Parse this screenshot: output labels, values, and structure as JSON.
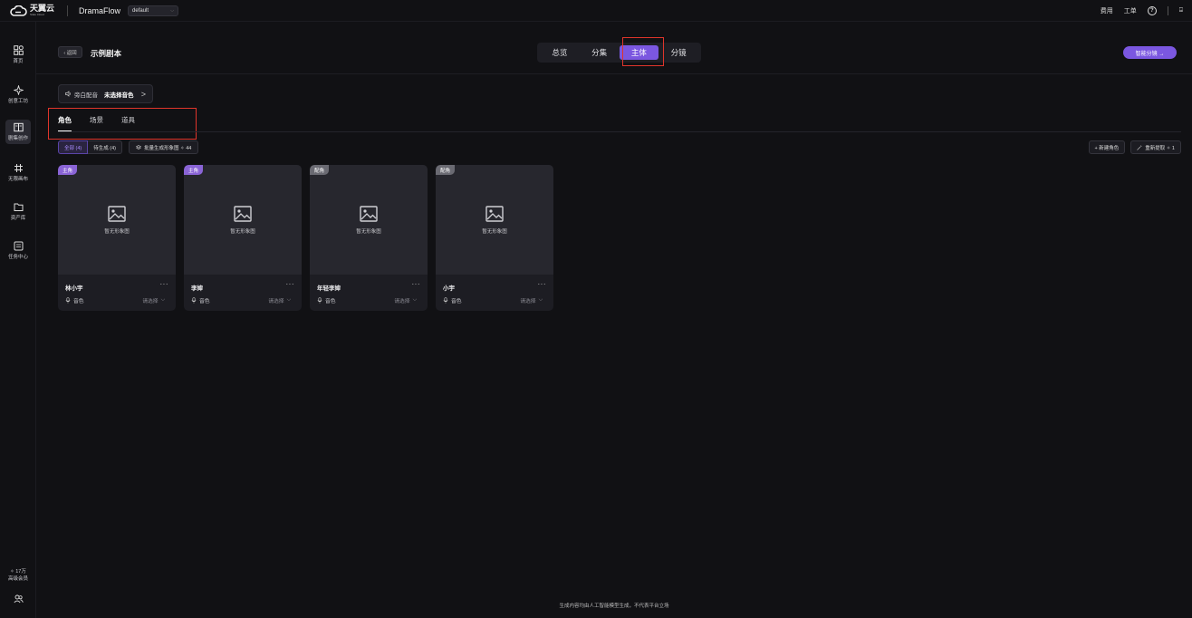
{
  "topbar": {
    "logo_zh": "天翼云",
    "logo_en": "State Cloud",
    "app_name": "DramaFlow",
    "env_select": "default",
    "right_items": [
      "费用",
      "工单"
    ],
    "help_glyph": "?",
    "user_glyph": "⍈"
  },
  "sidebar": {
    "items": [
      {
        "label": "首页",
        "icon": "grid-icon"
      },
      {
        "label": "创意工坊",
        "icon": "sparkle-icon"
      },
      {
        "label": "剧集创作",
        "icon": "book-icon"
      },
      {
        "label": "无限画布",
        "icon": "hash-icon"
      },
      {
        "label": "资产库",
        "icon": "folder-icon"
      },
      {
        "label": "任务中心",
        "icon": "task-icon"
      }
    ],
    "credits": "✧ 17万",
    "membership": "高级会员"
  },
  "header": {
    "back_label": "‹ 返回",
    "title": "示例剧本",
    "tabs": [
      "总览",
      "分集",
      "主体",
      "分镜"
    ],
    "active_tab": "主体",
    "smart_button": "智能分镜 →"
  },
  "voice": {
    "label": "旁白配音",
    "value": "未选择音色",
    "chevron": ">"
  },
  "sub_tabs": [
    "角色",
    "场景",
    "道具"
  ],
  "filters": {
    "all": "全部 (4)",
    "pending": "待生成 (4)",
    "batch": "批量生成形象图 ✧ 44",
    "new_role": "+ 新建角色",
    "re_extract": "重新提取 ✧ 1"
  },
  "cards": [
    {
      "badge": "主角",
      "name": "林小宇",
      "placeholder": "暂无形象图",
      "voice_label": "音色",
      "pick": "请选择",
      "more": "···"
    },
    {
      "badge": "主角",
      "name": "李婶",
      "placeholder": "暂无形象图",
      "voice_label": "音色",
      "pick": "请选择",
      "more": "···"
    },
    {
      "badge": "配角",
      "name": "年轻李婶",
      "placeholder": "暂无形象图",
      "voice_label": "音色",
      "pick": "请选择",
      "more": "···"
    },
    {
      "badge": "配角",
      "name": "小宇",
      "placeholder": "暂无形象图",
      "voice_label": "音色",
      "pick": "请选择",
      "more": "···"
    }
  ],
  "footer_note": "生成内容均由人工智能模型生成，不代表平台立场",
  "colors": {
    "accent": "#7b57e0",
    "highlight": "#e0352b",
    "background": "#111114"
  }
}
